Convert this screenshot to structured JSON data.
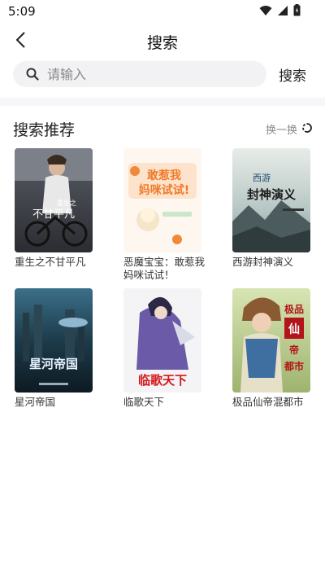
{
  "status": {
    "time": "5:09"
  },
  "header": {
    "title": "搜索"
  },
  "search": {
    "placeholder": "请输入",
    "value": "",
    "button_label": "搜索"
  },
  "section": {
    "title": "搜索推荐",
    "refresh_label": "换一换"
  },
  "books": [
    {
      "title": "重生之不甘平凡",
      "cover_text": "不甘平凡",
      "cover_top": "重生之"
    },
    {
      "title": "恶魔宝宝：敢惹我妈咪试试！",
      "cover_text": "敢惹我妈咪试试!"
    },
    {
      "title": "西游封神演义",
      "cover_text": "封神演义",
      "cover_top": "西游"
    },
    {
      "title": "星河帝国",
      "cover_text": "星河帝国"
    },
    {
      "title": "临歌天下",
      "cover_text": "临歌天下"
    },
    {
      "title": "极品仙帝混都市",
      "cover_text": "极品仙帝都市"
    }
  ]
}
